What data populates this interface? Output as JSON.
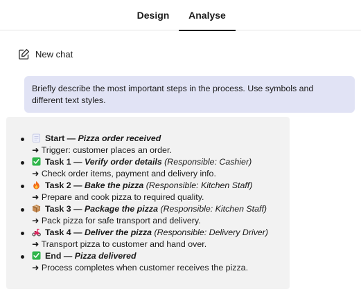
{
  "tabs": [
    {
      "label": "Design"
    },
    {
      "label": "Analyse"
    }
  ],
  "active_tab": "Analyse",
  "new_chat": {
    "label": "New chat",
    "icon": "edit-icon"
  },
  "user_message": "Briefly describe the most important steps in the process. Use symbols and different text styles.",
  "steps": [
    {
      "icon": "clipboard-icon",
      "label": "Start",
      "sep": " — ",
      "title": "Pizza order received",
      "responsible": "",
      "detail": "➜ Trigger: customer places an order."
    },
    {
      "icon": "check-icon",
      "label": "Task 1",
      "sep": " — ",
      "title": "Verify order details",
      "responsible": " (Responsible: Cashier)",
      "detail": "➜ Check order items, payment and delivery info."
    },
    {
      "icon": "fire-icon",
      "label": "Task 2",
      "sep": " — ",
      "title": "Bake the pizza",
      "responsible": " (Responsible: Kitchen Staff)",
      "detail": "➜ Prepare and cook pizza to required quality."
    },
    {
      "icon": "package-icon",
      "label": "Task 3",
      "sep": " — ",
      "title": "Package the pizza",
      "responsible": " (Responsible: Kitchen Staff)",
      "detail": "➜ Pack pizza for safe transport and delivery."
    },
    {
      "icon": "scooter-icon",
      "label": "Task 4",
      "sep": " — ",
      "title": "Deliver the pizza",
      "responsible": " (Responsible: Delivery Driver)",
      "detail": "➜ Transport pizza to customer and hand over."
    },
    {
      "icon": "check-icon",
      "label": "End",
      "sep": " — ",
      "title": "Pizza delivered",
      "responsible": "",
      "detail": "➜ Process completes when customer receives the pizza."
    }
  ],
  "colors": {
    "user_bubble": "#e1e3f5",
    "bot_bubble": "#f2f2f2",
    "check_green": "#2fb54a",
    "fire": "#f26a1b",
    "package": "#a8723e",
    "scooter": "#e0245e"
  }
}
